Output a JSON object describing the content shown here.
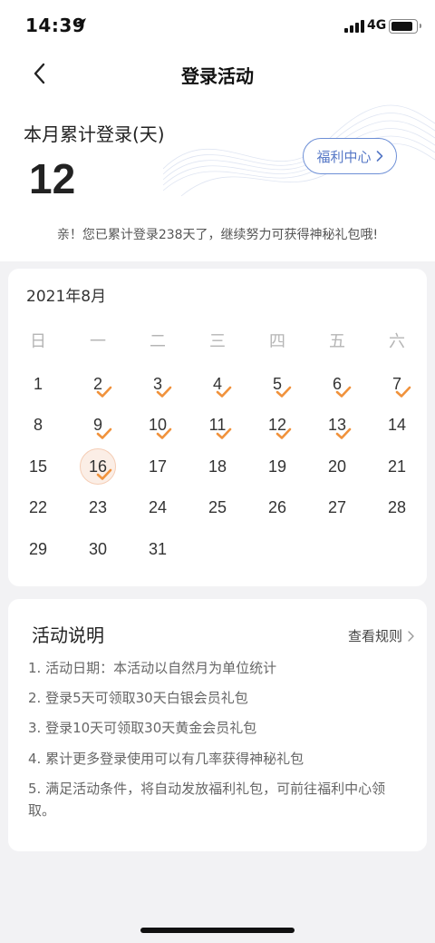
{
  "status_bar": {
    "time": "14:39",
    "network": "4G"
  },
  "nav": {
    "title": "登录活动"
  },
  "summary": {
    "label": "本月累计登录(天)",
    "count": "12",
    "welfare_button": "福利中心",
    "note": "亲！您已累计登录238天了，继续努力可获得神秘礼包哦!"
  },
  "calendar": {
    "month_label": "2021年8月",
    "weekdays": [
      "日",
      "一",
      "二",
      "三",
      "四",
      "五",
      "六"
    ],
    "first_weekday": 0,
    "days_in_month": 31,
    "today": 16,
    "checked_days": [
      2,
      3,
      4,
      5,
      6,
      7,
      9,
      10,
      11,
      12,
      13,
      16
    ],
    "check_color": "#f0923c"
  },
  "rules": {
    "title": "活动说明",
    "link": "查看规则",
    "items": [
      "1. 活动日期：本活动以自然月为单位统计",
      "2. 登录5天可领取30天白银会员礼包",
      "3. 登录10天可领取30天黄金会员礼包",
      "4. 累计更多登录使用可以有几率获得神秘礼包",
      "5. 满足活动条件，将自动发放福利礼包，可前往福利中心领取。"
    ]
  }
}
